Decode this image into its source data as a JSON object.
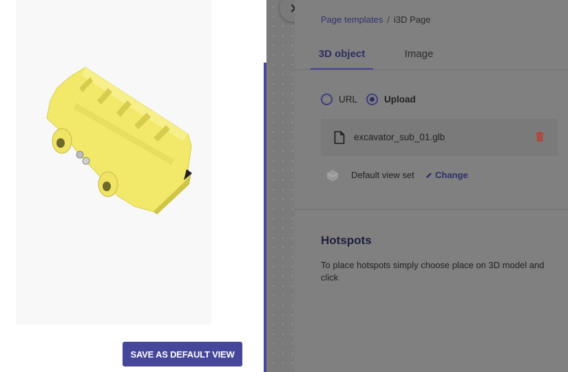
{
  "viewer": {
    "model_color": "#f2e96a",
    "save_button_label": "SAVE AS DEFAULT VIEW"
  },
  "editor": {
    "breadcrumb": {
      "parent": "Page templates",
      "separator": "/",
      "current": "i3D Page"
    },
    "tabs": [
      {
        "label": "3D object",
        "active": true
      },
      {
        "label": "Image",
        "active": false
      }
    ],
    "source": {
      "options": [
        {
          "label": "URL",
          "checked": false
        },
        {
          "label": "Upload",
          "checked": true
        }
      ]
    },
    "file": {
      "name": "excavator_sub_01.glb"
    },
    "view": {
      "status": "Default view set",
      "change_label": "Change"
    },
    "hotspots": {
      "title": "Hotspots",
      "description": "To place hotspots simply choose place on 3D model and click"
    }
  },
  "colors": {
    "accent": "#46469a",
    "overlay": "#808080",
    "delete": "#c0392b"
  }
}
